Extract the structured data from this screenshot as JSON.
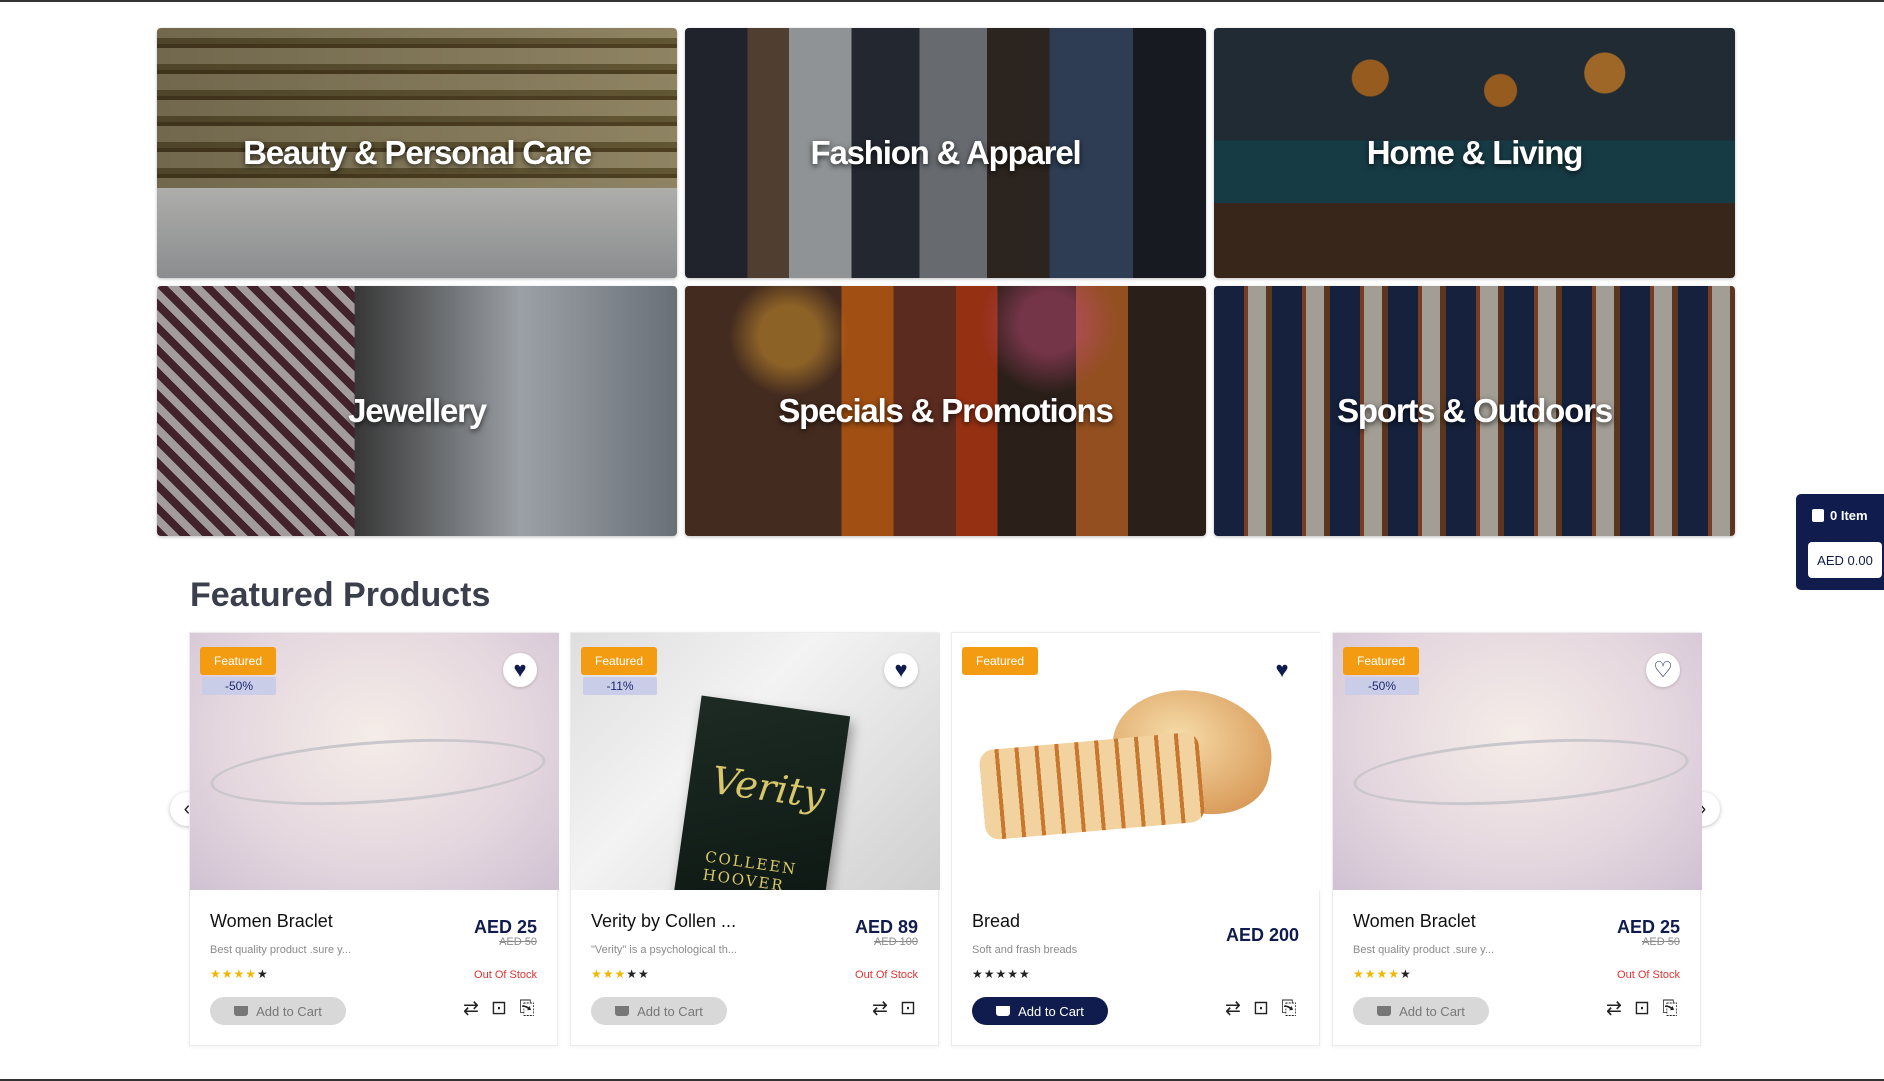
{
  "categories": [
    {
      "label": "Beauty & Personal Care"
    },
    {
      "label": "Fashion & Apparel"
    },
    {
      "label": "Home & Living"
    },
    {
      "label": "Jewellery"
    },
    {
      "label": "Specials & Promotions"
    },
    {
      "label": "Sports & Outdoors"
    }
  ],
  "cart": {
    "items": "0 Item",
    "total": "AED 0.00"
  },
  "featured": {
    "title": "Featured Products",
    "badge": "Featured",
    "add_label": "Add to Cart",
    "out_of_stock": "Out Of Stock",
    "products": [
      {
        "name": "Women Braclet",
        "desc": "Best quality product .sure y...",
        "price": "AED 25",
        "old_price": "AED 50",
        "discount": "-50%",
        "rating": 4,
        "wishlisted": true,
        "in_stock": false
      },
      {
        "name": "Verity by Collen ...",
        "desc": "\"Verity\" is a psychological th...",
        "price": "AED 89",
        "old_price": "AED 100",
        "discount": "-11%",
        "rating": 3,
        "wishlisted": true,
        "in_stock": false
      },
      {
        "name": "Bread",
        "desc": "Soft and frash breads",
        "price": "AED 200",
        "old_price": "",
        "discount": "",
        "rating": 0,
        "wishlisted": true,
        "in_stock": true
      },
      {
        "name": "Women Braclet",
        "desc": "Best quality product .sure y...",
        "price": "AED 25",
        "old_price": "AED 50",
        "discount": "-50%",
        "rating": 4,
        "wishlisted": false,
        "in_stock": false
      }
    ]
  },
  "book_cover": {
    "title": "Verity",
    "author": "COLLEEN HOOVER"
  },
  "icons": {
    "cart": "shopping-bag-icon",
    "wishlist": "heart-icon",
    "prev": "chevron-left-icon",
    "next": "chevron-right-icon",
    "actions": [
      "compare-icon",
      "quick-view-icon",
      "share-icon"
    ]
  },
  "colors": {
    "brand": "#0f1c4d",
    "badge": "#f39c12",
    "out_of_stock": "#e03131",
    "star": "#f1b600"
  }
}
